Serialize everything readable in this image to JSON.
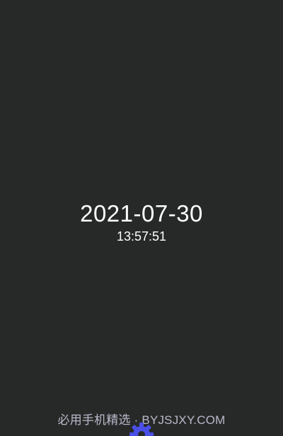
{
  "clock": {
    "date": "2021-07-30",
    "time": "13:57:51"
  },
  "watermark": {
    "text": "必用手机精选 · BYJSJXY.COM"
  },
  "settings": {
    "icon": "gear-icon",
    "color": "#4a4fe6"
  },
  "colors": {
    "background": "#272929",
    "text": "#ffffff",
    "watermark": "#b9b9c9"
  }
}
